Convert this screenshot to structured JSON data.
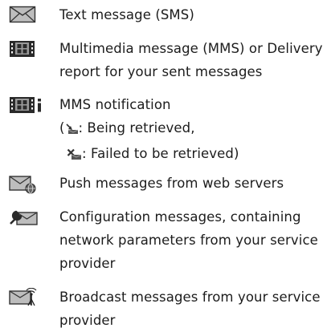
{
  "entries": [
    {
      "icon": "closed-envelope-icon",
      "lines": [
        "Text message (SMS)"
      ]
    },
    {
      "icon": "multimedia-message-icon",
      "lines": [
        "Multimedia message (MMS) or Delivery",
        "report for your sent messages"
      ]
    },
    {
      "icon": "mms-notification-icon",
      "lines": [
        "MMS notification"
      ],
      "sub_items": [
        {
          "prefix": "(",
          "icon": "retrieving-arrow-icon",
          "text": ": Being retrieved,"
        },
        {
          "prefix": "",
          "icon": "retrieval-failed-icon",
          "text": ": Failed to be retrieved)"
        }
      ]
    },
    {
      "icon": "push-message-icon",
      "lines": [
        "Push messages from web servers"
      ]
    },
    {
      "icon": "configuration-message-icon",
      "lines": [
        "Configuration messages, containing",
        "network parameters from your service",
        "provider"
      ]
    },
    {
      "icon": "broadcast-message-icon",
      "lines": [
        "Broadcast messages from your service",
        "provider"
      ]
    }
  ]
}
